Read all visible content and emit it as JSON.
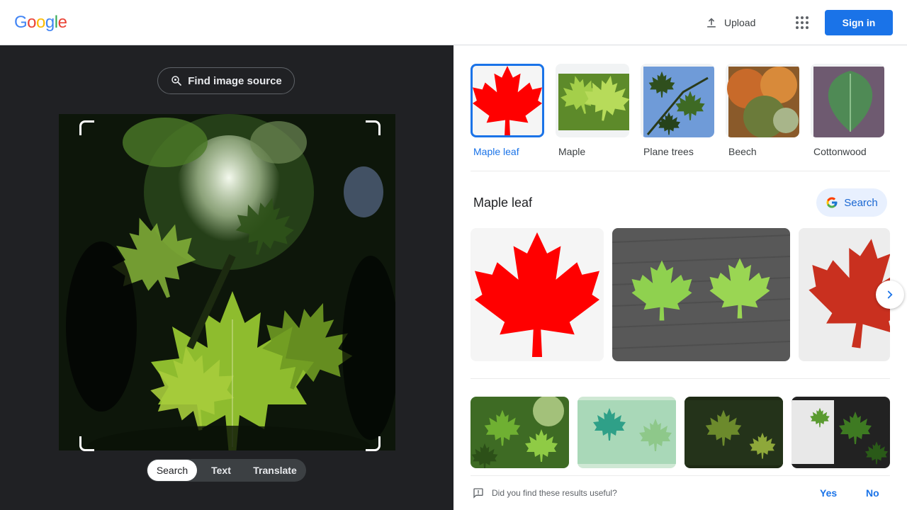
{
  "header": {
    "logo_letters": [
      {
        "ch": "G",
        "color": "#4285F4"
      },
      {
        "ch": "o",
        "color": "#EA4335"
      },
      {
        "ch": "o",
        "color": "#FBBC05"
      },
      {
        "ch": "g",
        "color": "#4285F4"
      },
      {
        "ch": "l",
        "color": "#34A853"
      },
      {
        "ch": "e",
        "color": "#EA4335"
      }
    ],
    "upload_label": "Upload",
    "apps_icon": "apps-grid-icon",
    "signin_label": "Sign in"
  },
  "lens": {
    "find_source_label": "Find image source",
    "modes": [
      "Search",
      "Text",
      "Translate"
    ],
    "active_mode": "Search"
  },
  "related": {
    "chips": [
      {
        "label": "Maple leaf",
        "selected": true
      },
      {
        "label": "Maple",
        "selected": false
      },
      {
        "label": "Plane trees",
        "selected": false
      },
      {
        "label": "Beech",
        "selected": false
      },
      {
        "label": "Cottonwood",
        "selected": false
      }
    ]
  },
  "section": {
    "title": "Maple leaf",
    "search_label": "Search"
  },
  "feedback": {
    "question": "Did you find these results useful?",
    "yes": "Yes",
    "no": "No"
  },
  "colors": {
    "accent": "#1a73e8",
    "dark_panel": "#202124",
    "maple_red": "#ff0000"
  }
}
